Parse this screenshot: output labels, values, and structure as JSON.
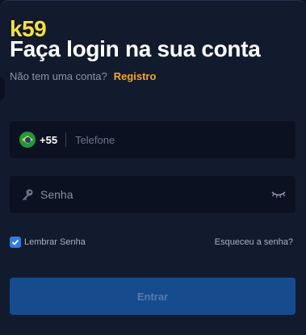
{
  "brand": {
    "logo_text": "k59"
  },
  "header": {
    "title": "Faça login na sua conta",
    "no_account_text": "Não tem uma conta?",
    "register_link": "Registro"
  },
  "form": {
    "phone": {
      "country_flag": "brazil-flag-icon",
      "dial_code": "+55",
      "placeholder": "Telefone",
      "value": ""
    },
    "password": {
      "placeholder": "Senha",
      "value": "",
      "leading_icon": "key-icon",
      "trailing_icon": "eye-closed-icon"
    },
    "remember": {
      "label": "Lembrar Senha",
      "checked": true
    },
    "forgot_link": "Esqueceu a senha?",
    "submit_label": "Entrar"
  },
  "colors": {
    "background": "#121b2e",
    "field": "#0b1120",
    "accent_link": "#f5a524",
    "logo": "#f4e13a",
    "button": "#164c8e",
    "checkbox": "#2f7be0"
  }
}
